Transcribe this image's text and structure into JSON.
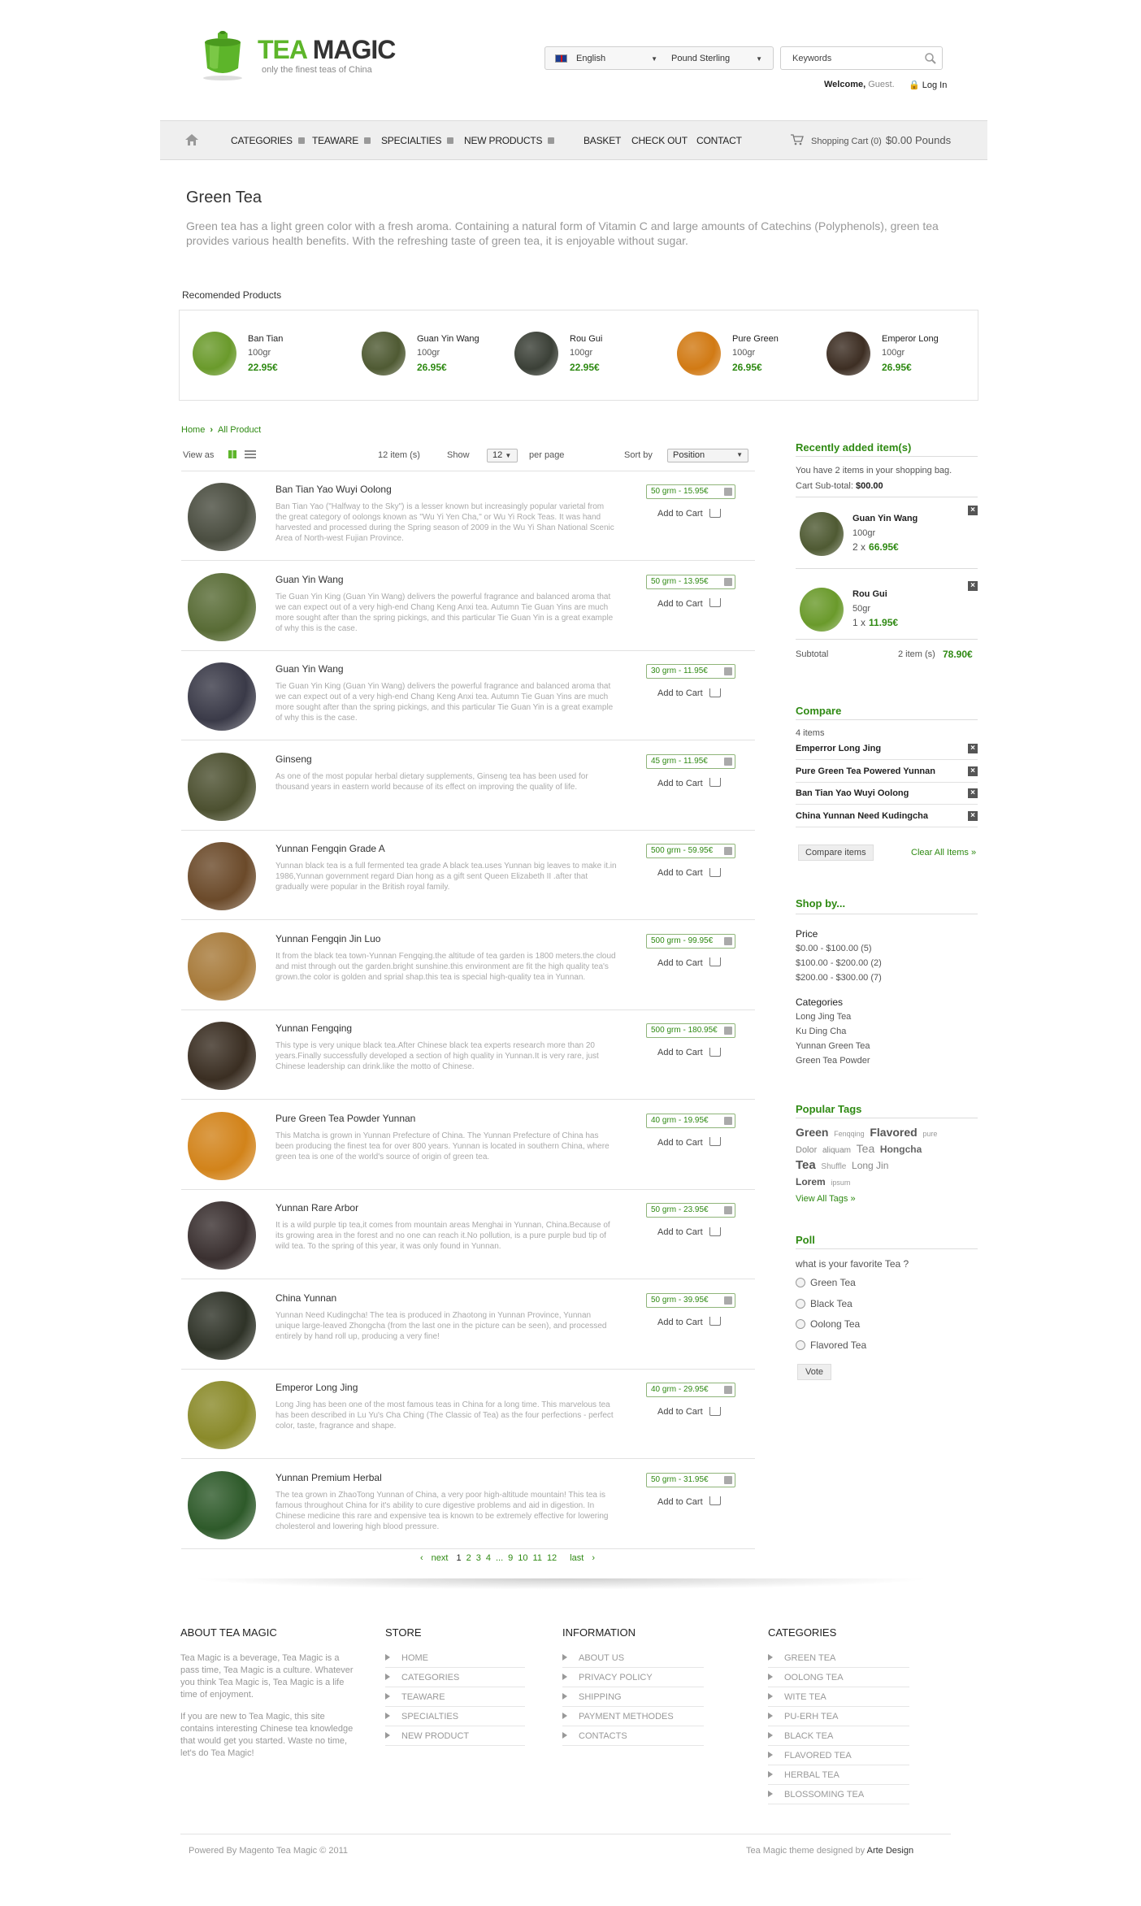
{
  "brand": {
    "name_part1": "TEA",
    "name_part2": "MAGIC",
    "tagline": "only the finest teas of China"
  },
  "header": {
    "language": "English",
    "currency": "Pound Sterling",
    "keywords_placeholder": "Keywords",
    "welcome": "Welcome,",
    "guest": "Guest.",
    "login": "Log In"
  },
  "nav": {
    "items": [
      "CATEGORIES",
      "TEAWARE",
      "SPECIALTIES",
      "NEW PRODUCTS",
      "BASKET",
      "CHECK OUT",
      "CONTACT"
    ],
    "cart_label": "Shopping Cart (0)",
    "cart_price": "$0.00 Pounds"
  },
  "category": {
    "title": "Green Tea",
    "description": "Green tea has a light green color with a fresh aroma. Containing a natural form of Vitamin C and large amounts of Catechins (Polyphenols), green tea provides various health benefits. With the refreshing taste of green tea, it is enjoyable without sugar."
  },
  "recommended": {
    "title": "Recomended Products",
    "items": [
      {
        "name": "Ban Tian",
        "weight": "100gr",
        "price": "22.95€",
        "color": "#6a9a2b"
      },
      {
        "name": "Guan Yin Wang",
        "weight": "100gr",
        "price": "26.95€",
        "color": "#4f5a33"
      },
      {
        "name": "Rou Gui",
        "weight": "100gr",
        "price": "22.95€",
        "color": "#3b4037"
      },
      {
        "name": "Pure Green",
        "weight": "100gr",
        "price": "26.95€",
        "color": "#d17a14"
      },
      {
        "name": "Emperor Long",
        "weight": "100gr",
        "price": "26.95€",
        "color": "#3d2e23"
      }
    ]
  },
  "breadcrumb": {
    "home": "Home",
    "current": "All Product"
  },
  "toolbar": {
    "view_as": "View as",
    "count": "12 item (s)",
    "show": "Show",
    "show_value": "12",
    "per_page": "per page",
    "sort_by": "Sort by",
    "sort_value": "Position"
  },
  "products": [
    {
      "name": "Ban Tian Yao Wuyi Oolong",
      "desc": "Ban Tian Yao (\"Halfway to the Sky\") is a lesser known but increasingly popular varietal from the great category of oolongs known as \"Wu Yi Yen Cha,\" or Wu Yi Rock Teas. It was hand harvested and processed during the Spring season of 2009 in the Wu Yi Shan National Scenic Area of North-west Fujian Province.",
      "option": "50 grm - 15.95€",
      "color": "#4a4d40"
    },
    {
      "name": "Guan Yin Wang",
      "desc": "Tie Guan Yin King (Guan Yin Wang) delivers the powerful fragrance and balanced aroma that we can expect out of a very high-end Chang Keng Anxi tea. Autumn Tie Guan Yins are much more sought after than the spring pickings, and this particular Tie Guan Yin is a great example of why this is the case.",
      "option": "50 grm - 13.95€",
      "color": "#586b35"
    },
    {
      "name": "Guan Yin Wang",
      "desc": "Tie Guan Yin King (Guan Yin Wang) delivers the powerful fragrance and balanced aroma that we can expect out of a very high-end Chang Keng Anxi tea. Autumn Tie Guan Yins are much more sought after than the spring pickings, and this particular Tie Guan Yin is a great example of why this is the case.",
      "option": "30 grm - 11.95€",
      "color": "#3a3a48"
    },
    {
      "name": "Ginseng",
      "desc": "As one of the most popular herbal dietary supplements, Ginseng tea has been used for thousand years in eastern world because of its effect on improving the quality of life.",
      "option": "45 grm - 11.95€",
      "color": "#4c5030"
    },
    {
      "name": "Yunnan Fengqin Grade A",
      "desc": "Yunnan black tea is a full fermented tea grade A black tea.uses Yunnan big leaves to make it.in 1986,Yunnan government regard Dian hong as a gift sent Queen Elizabeth II .after that gradually were popular in the British royal family.",
      "option": "500 grm - 59.95€",
      "color": "#6b4a2a"
    },
    {
      "name": "Yunnan Fengqin Jin Luo",
      "desc": "It from the black tea town-Yunnan Fengqing.the altitude of tea garden is 1800 meters.the cloud and mist through out the garden.bright sunshine.this environment are fit the high quality tea's grown.the color is golden and sprial shap.this tea is special high-quality tea in Yunnan.",
      "option": "500 grm - 99.95€",
      "color": "#a77a3a"
    },
    {
      "name": "Yunnan Fengqing",
      "desc": "This type is very unique black tea.After Chinese black tea experts research more than 20 years.Finally successfully developed a section of high quality in Yunnan.It is very rare, just Chinese leadership can drink.like the motto of Chinese.",
      "option": "500 grm - 180.95€",
      "color": "#3a2e22"
    },
    {
      "name": "Pure Green Tea Powder Yunnan",
      "desc": "This Matcha is grown in Yunnan Prefecture of China. The Yunnan Prefecture of China has been producing the finest tea for over 800 years. Yunnan is located in southern China, where green tea is one of the world's source of origin of green tea.",
      "option": "40 grm - 19.95€",
      "color": "#d2831a"
    },
    {
      "name": "Yunnan Rare Arbor",
      "desc": "It is a wild purple tip tea,it comes from mountain areas Menghai in Yunnan, China.Because of its growing area in the forest and no one can reach it.No pollution, is a pure purple bud tip of wild tea. To the spring of this year, it was only found in Yunnan.",
      "option": "50 grm - 23.95€",
      "color": "#3a3030"
    },
    {
      "name": "China Yunnan",
      "desc": "Yunnan Need Kudingcha! The tea is produced in Zhaotong in Yunnan Province, Yunnan unique large-leaved Zhongcha (from the last one in the picture can be seen), and processed entirely by hand roll up, producing a very fine!",
      "option": "50 grm - 39.95€",
      "color": "#2f3328"
    },
    {
      "name": "Emperor Long Jing",
      "desc": "Long Jing has been one of the most famous teas in China for a long time. This marvelous tea has been described in Lu Yu's Cha Ching (The Classic of Tea) as the four perfections - perfect color, taste, fragrance and shape.",
      "option": "40 grm - 29.95€",
      "color": "#8a8a2a"
    },
    {
      "name": "Yunnan Premium Herbal",
      "desc": "The tea grown in ZhaoTong Yunnan of China, a very poor high-altitude mountain! This tea is famous throughout China for it's ability to cure digestive problems and aid in digestion. In Chinese medicine this rare and expensive tea is known to be extremely effective for lowering cholesterol and lowering high blood pressure.",
      "option": "50 grm - 31.95€",
      "color": "#2e5a2a"
    }
  ],
  "add_to_cart": "Add to Cart",
  "pager": {
    "prev": "next",
    "pages": [
      "1",
      "2",
      "3",
      "4",
      "...",
      "9",
      "10",
      "11",
      "12"
    ],
    "last": "last"
  },
  "recent": {
    "title": "Recently added item(s)",
    "info": "You have 2 items in your shopping bag.",
    "subtotal_label": "Cart Sub-total:",
    "subtotal_value": "$00.00",
    "items": [
      {
        "name": "Guan Yin Wang",
        "weight": "100gr",
        "qty": "2 x",
        "price": "66.95€",
        "color": "#4f5a33"
      },
      {
        "name": "Rou Gui",
        "weight": "50gr",
        "qty": "1 x",
        "price": "11.95€",
        "color": "#6a9a2b"
      }
    ],
    "footer_label": "Subtotal",
    "footer_count": "2 item (s)",
    "footer_total": "78.90€"
  },
  "compare": {
    "title": "Compare",
    "count": "4 items",
    "items": [
      "Emperror Long Jing",
      "Pure Green Tea Powered Yunnan",
      "Ban Tian Yao Wuyi Oolong",
      "China Yunnan Need Kudingcha"
    ],
    "compare_btn": "Compare items",
    "clear": "Clear All Items"
  },
  "shopby": {
    "title": "Shop by...",
    "price_label": "Price",
    "prices": [
      "$0.00 - $100.00 (5)",
      "$100.00 - $200.00 (2)",
      "$200.00 - $300.00 (7)"
    ],
    "cat_label": "Categories",
    "cats": [
      "Long Jing Tea",
      "Ku Ding Cha",
      "Yunnan Green Tea",
      "Green Tea Powder"
    ]
  },
  "tags": {
    "title": "Popular Tags",
    "list": [
      [
        "Green",
        "Fenqqing",
        "Flavored",
        "pure"
      ],
      [
        "Dolor",
        "aliquam",
        "Tea",
        "Hongcha"
      ],
      [
        "Tea",
        "Shuffle",
        "Long Jin"
      ],
      [
        "Lorem",
        "ipsum"
      ]
    ],
    "view_all": "View All Tags"
  },
  "poll": {
    "title": "Poll",
    "question": "what is your favorite Tea ?",
    "options": [
      "Green Tea",
      "Black Tea",
      "Oolong Tea",
      "Flavored Tea"
    ],
    "vote": "Vote"
  },
  "footer": {
    "about_title": "ABOUT TEA MAGIC",
    "about_p1": "Tea Magic is a beverage, Tea Magic is a pass time, Tea Magic is a culture. Whatever you think Tea Magic is, Tea Magic is a life time of enjoyment.",
    "about_p2": "If you are new to Tea Magic, this site contains interesting Chinese tea knowledge that would get you started. Waste no time, let's do Tea Magic!",
    "store_title": "STORE",
    "store": [
      "HOME",
      "CATEGORIES",
      "TEAWARE",
      "SPECIALTIES",
      "NEW PRODUCT"
    ],
    "info_title": "INFORMATION",
    "info": [
      "ABOUT US",
      "PRIVACY POLICY",
      "SHIPPING",
      "PAYMENT METHODES",
      "CONTACTS"
    ],
    "cat_title": "CATEGORIES",
    "cats": [
      "GREEN TEA",
      "OOLONG TEA",
      "WITE TEA",
      "PU-ERH TEA",
      "BLACK TEA",
      "FLAVORED TEA",
      "HERBAL TEA",
      "BLOSSOMING TEA"
    ],
    "powered": "Powered By Magento Tea Magic © 2011",
    "designed": "Tea Magic theme designed by",
    "designer": "Arte Design"
  }
}
